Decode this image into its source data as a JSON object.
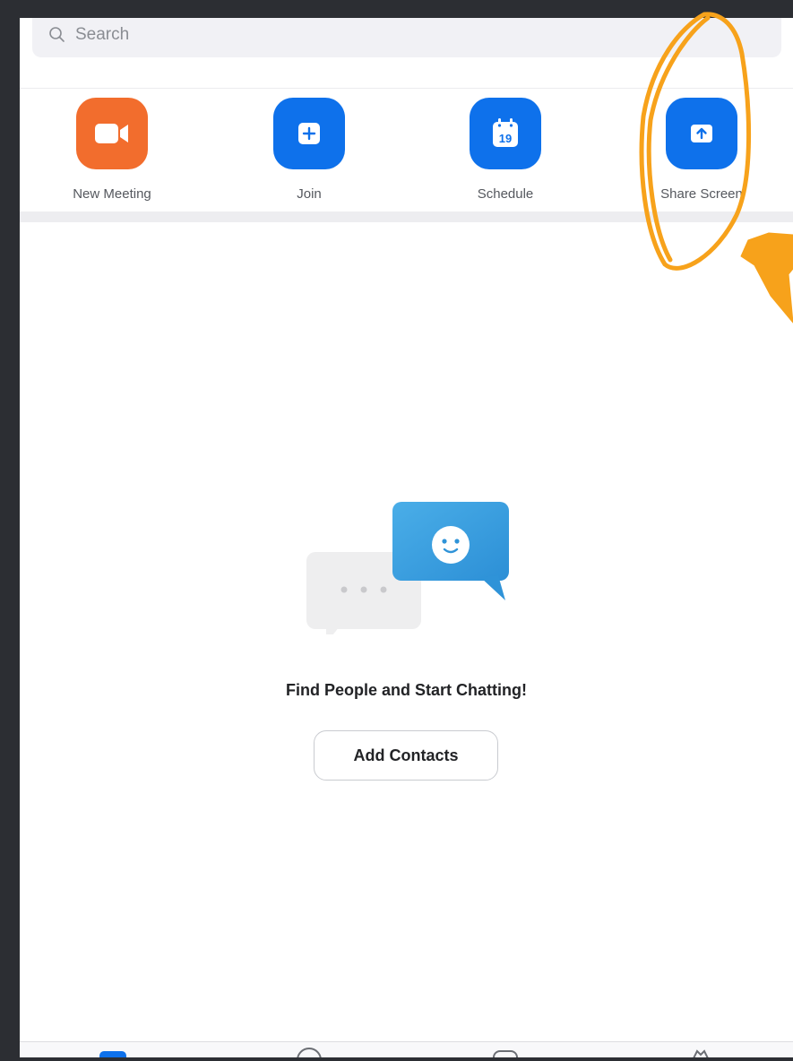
{
  "search": {
    "placeholder": "Search",
    "icon": "search-icon"
  },
  "actions": [
    {
      "label": "New Meeting",
      "icon": "video-camera-icon",
      "color": "#f26d2d"
    },
    {
      "label": "Join",
      "icon": "plus-icon",
      "color": "#0e71eb"
    },
    {
      "label": "Schedule",
      "icon": "calendar-icon",
      "color": "#0e71eb",
      "calendar_day": "19"
    },
    {
      "label": "Share Screen",
      "icon": "share-screen-icon",
      "color": "#0e71eb"
    }
  ],
  "empty_state": {
    "title": "Find People and Start Chatting!",
    "button_label": "Add Contacts",
    "illustration": "chat-bubbles-illustration"
  },
  "tabbar": {
    "icons": [
      "meetings-tab-icon",
      "chat-tab-icon",
      "contacts-tab-icon",
      "settings-tab-icon"
    ]
  },
  "annotation": {
    "color": "#f7a21b",
    "shapes": [
      "circle-highlight",
      "arrow"
    ]
  }
}
